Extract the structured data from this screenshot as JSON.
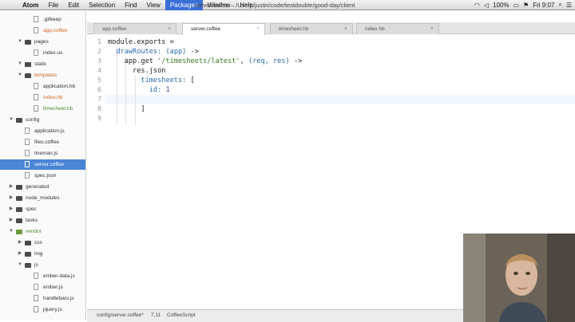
{
  "menubar": {
    "app": "Atom",
    "items": [
      "File",
      "Edit",
      "Selection",
      "Find",
      "View",
      "Packages",
      "Window",
      "Help"
    ],
    "active": "Packages",
    "window_title": "server.coffee – /Users/justin/code/testdouble/good-day/client",
    "battery": "100%",
    "clock": "Fri 9:07"
  },
  "tree": {
    "items": [
      {
        "label": ".gitkeep",
        "type": "file",
        "depth": 3
      },
      {
        "label": "app.coffee",
        "type": "file",
        "depth": 3,
        "color": "orange"
      },
      {
        "label": "pages",
        "type": "folder",
        "depth": 2,
        "open": true
      },
      {
        "label": "index.us",
        "type": "file",
        "depth": 3
      },
      {
        "label": "static",
        "type": "folder",
        "depth": 2,
        "open": true
      },
      {
        "label": "templates",
        "type": "folder",
        "depth": 2,
        "open": true,
        "color": "orange"
      },
      {
        "label": "application.hb",
        "type": "file",
        "depth": 3
      },
      {
        "label": "index.hb",
        "type": "file",
        "depth": 3,
        "color": "orange"
      },
      {
        "label": "timesheet.hb",
        "type": "file",
        "depth": 3,
        "color": "green"
      },
      {
        "label": "config",
        "type": "folder",
        "depth": 1,
        "open": true
      },
      {
        "label": "application.js",
        "type": "file",
        "depth": 2
      },
      {
        "label": "files.coffee",
        "type": "file",
        "depth": 2
      },
      {
        "label": "lineman.js",
        "type": "file",
        "depth": 2
      },
      {
        "label": "server.coffee",
        "type": "file",
        "depth": 2,
        "selected": true
      },
      {
        "label": "spec.json",
        "type": "file",
        "depth": 2
      },
      {
        "label": "generated",
        "type": "folder",
        "depth": 1,
        "open": false
      },
      {
        "label": "node_modules",
        "type": "folder",
        "depth": 1,
        "open": false
      },
      {
        "label": "spec",
        "type": "folder",
        "depth": 1,
        "open": false
      },
      {
        "label": "tasks",
        "type": "folder",
        "depth": 1,
        "open": false
      },
      {
        "label": "vendor",
        "type": "folder",
        "depth": 1,
        "open": true,
        "color": "green"
      },
      {
        "label": "css",
        "type": "folder",
        "depth": 2,
        "open": false
      },
      {
        "label": "img",
        "type": "folder",
        "depth": 2,
        "open": false
      },
      {
        "label": "js",
        "type": "folder",
        "depth": 2,
        "open": true
      },
      {
        "label": "ember-data.js",
        "type": "file",
        "depth": 3
      },
      {
        "label": "ember.js",
        "type": "file",
        "depth": 3
      },
      {
        "label": "handlebars.js",
        "type": "file",
        "depth": 3
      },
      {
        "label": "jquery.js",
        "type": "file",
        "depth": 3
      }
    ]
  },
  "tabs": [
    {
      "label": "app.coffee",
      "active": false
    },
    {
      "label": "server.coffee",
      "active": true
    },
    {
      "label": "timesheet.hb",
      "active": false
    },
    {
      "label": "index.hb",
      "active": false
    }
  ],
  "editor": {
    "line_numbers": [
      "1",
      "2",
      "3",
      "4",
      "5",
      "6",
      "7",
      "8",
      "9"
    ],
    "cursor_line": 7
  },
  "status": {
    "path": "config/server.coffee*",
    "position": "7,11",
    "grammar": "CoffeeScript"
  },
  "colors": {
    "selection": "#4a85d6",
    "keyword": "#2a6aa8",
    "string": "#3b7a22",
    "number": "#6a3aa0",
    "orange_file": "#d2691e",
    "green_file": "#4f8f2f"
  }
}
